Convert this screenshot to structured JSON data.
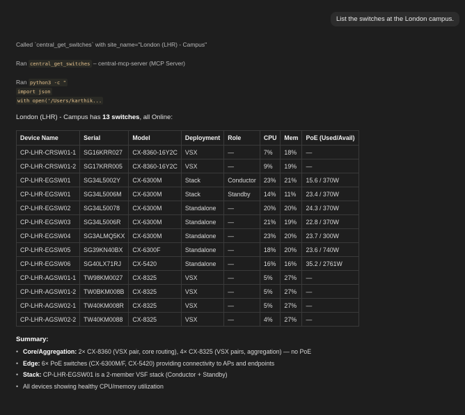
{
  "user_message": "List the switches at the London campus.",
  "call_line": {
    "prefix": "Called `central_get_switches` with site_name=\"London (LHR) - Campus\""
  },
  "ran_tool": {
    "prefix": "Ran",
    "tool": "central_get_switches",
    "suffix": "– central-mcp-server (MCP Server)"
  },
  "ran_python": {
    "prefix": "Ran",
    "command": "python3 -c \"",
    "code_line1": "import json",
    "code_line2": "with open('/Users/karthik..."
  },
  "intro": {
    "pre": "London (LHR) - Campus has ",
    "count": "13 switches",
    "post": ", all Online:"
  },
  "table": {
    "headers": [
      "Device Name",
      "Serial",
      "Model",
      "Deployment",
      "Role",
      "CPU",
      "Mem",
      "PoE (Used/Avail)"
    ],
    "rows": [
      [
        "CP-LHR-CRSW01-1",
        "SG16KRR027",
        "CX-8360-16Y2C",
        "VSX",
        "—",
        "7%",
        "18%",
        "—"
      ],
      [
        "CP-LHR-CRSW01-2",
        "SG17KRR005",
        "CX-8360-16Y2C",
        "VSX",
        "—",
        "9%",
        "19%",
        "—"
      ],
      [
        "CP-LHR-EGSW01",
        "SG34L5002Y",
        "CX-6300M",
        "Stack",
        "Conductor",
        "23%",
        "21%",
        "15.6 / 370W"
      ],
      [
        "CP-LHR-EGSW01",
        "SG34L5006M",
        "CX-6300M",
        "Stack",
        "Standby",
        "14%",
        "11%",
        "23.4 / 370W"
      ],
      [
        "CP-LHR-EGSW02",
        "SG34L50078",
        "CX-6300M",
        "Standalone",
        "—",
        "20%",
        "20%",
        "24.3 / 370W"
      ],
      [
        "CP-LHR-EGSW03",
        "SG34L5006R",
        "CX-6300M",
        "Standalone",
        "—",
        "21%",
        "19%",
        "22.8 / 370W"
      ],
      [
        "CP-LHR-EGSW04",
        "SG3ALMQ5KX",
        "CX-6300M",
        "Standalone",
        "—",
        "23%",
        "20%",
        "23.7 / 300W"
      ],
      [
        "CP-LHR-EGSW05",
        "SG39KN40BX",
        "CX-6300F",
        "Standalone",
        "—",
        "18%",
        "20%",
        "23.6 / 740W"
      ],
      [
        "CP-LHR-EGSW06",
        "SG40LX71RJ",
        "CX-5420",
        "Standalone",
        "—",
        "16%",
        "16%",
        "35.2 / 2761W"
      ],
      [
        "CP-LHR-AGSW01-1",
        "TW98KM0027",
        "CX-8325",
        "VSX",
        "—",
        "5%",
        "27%",
        "—"
      ],
      [
        "CP-LHR-AGSW01-2",
        "TW0BKM008B",
        "CX-8325",
        "VSX",
        "—",
        "5%",
        "27%",
        "—"
      ],
      [
        "CP-LHR-AGSW02-1",
        "TW40KM008R",
        "CX-8325",
        "VSX",
        "—",
        "5%",
        "27%",
        "—"
      ],
      [
        "CP-LHR-AGSW02-2",
        "TW40KM0088",
        "CX-8325",
        "VSX",
        "—",
        "4%",
        "27%",
        "—"
      ]
    ]
  },
  "summary": {
    "title": "Summary:",
    "items": [
      {
        "label": "Core/Aggregation:",
        "text": " 2× CX-8360 (VSX pair, core routing), 4× CX-8325 (VSX pairs, aggregation) — no PoE"
      },
      {
        "label": "Edge:",
        "text": " 6× PoE switches (CX-6300M/F, CX-5420) providing connectivity to APs and endpoints"
      },
      {
        "label": "Stack:",
        "text": " CP-LHR-EGSW01 is a 2-member VSF stack (Conductor + Standby)"
      },
      {
        "label": "",
        "text": "All devices showing healthy CPU/memory utilization"
      }
    ]
  }
}
